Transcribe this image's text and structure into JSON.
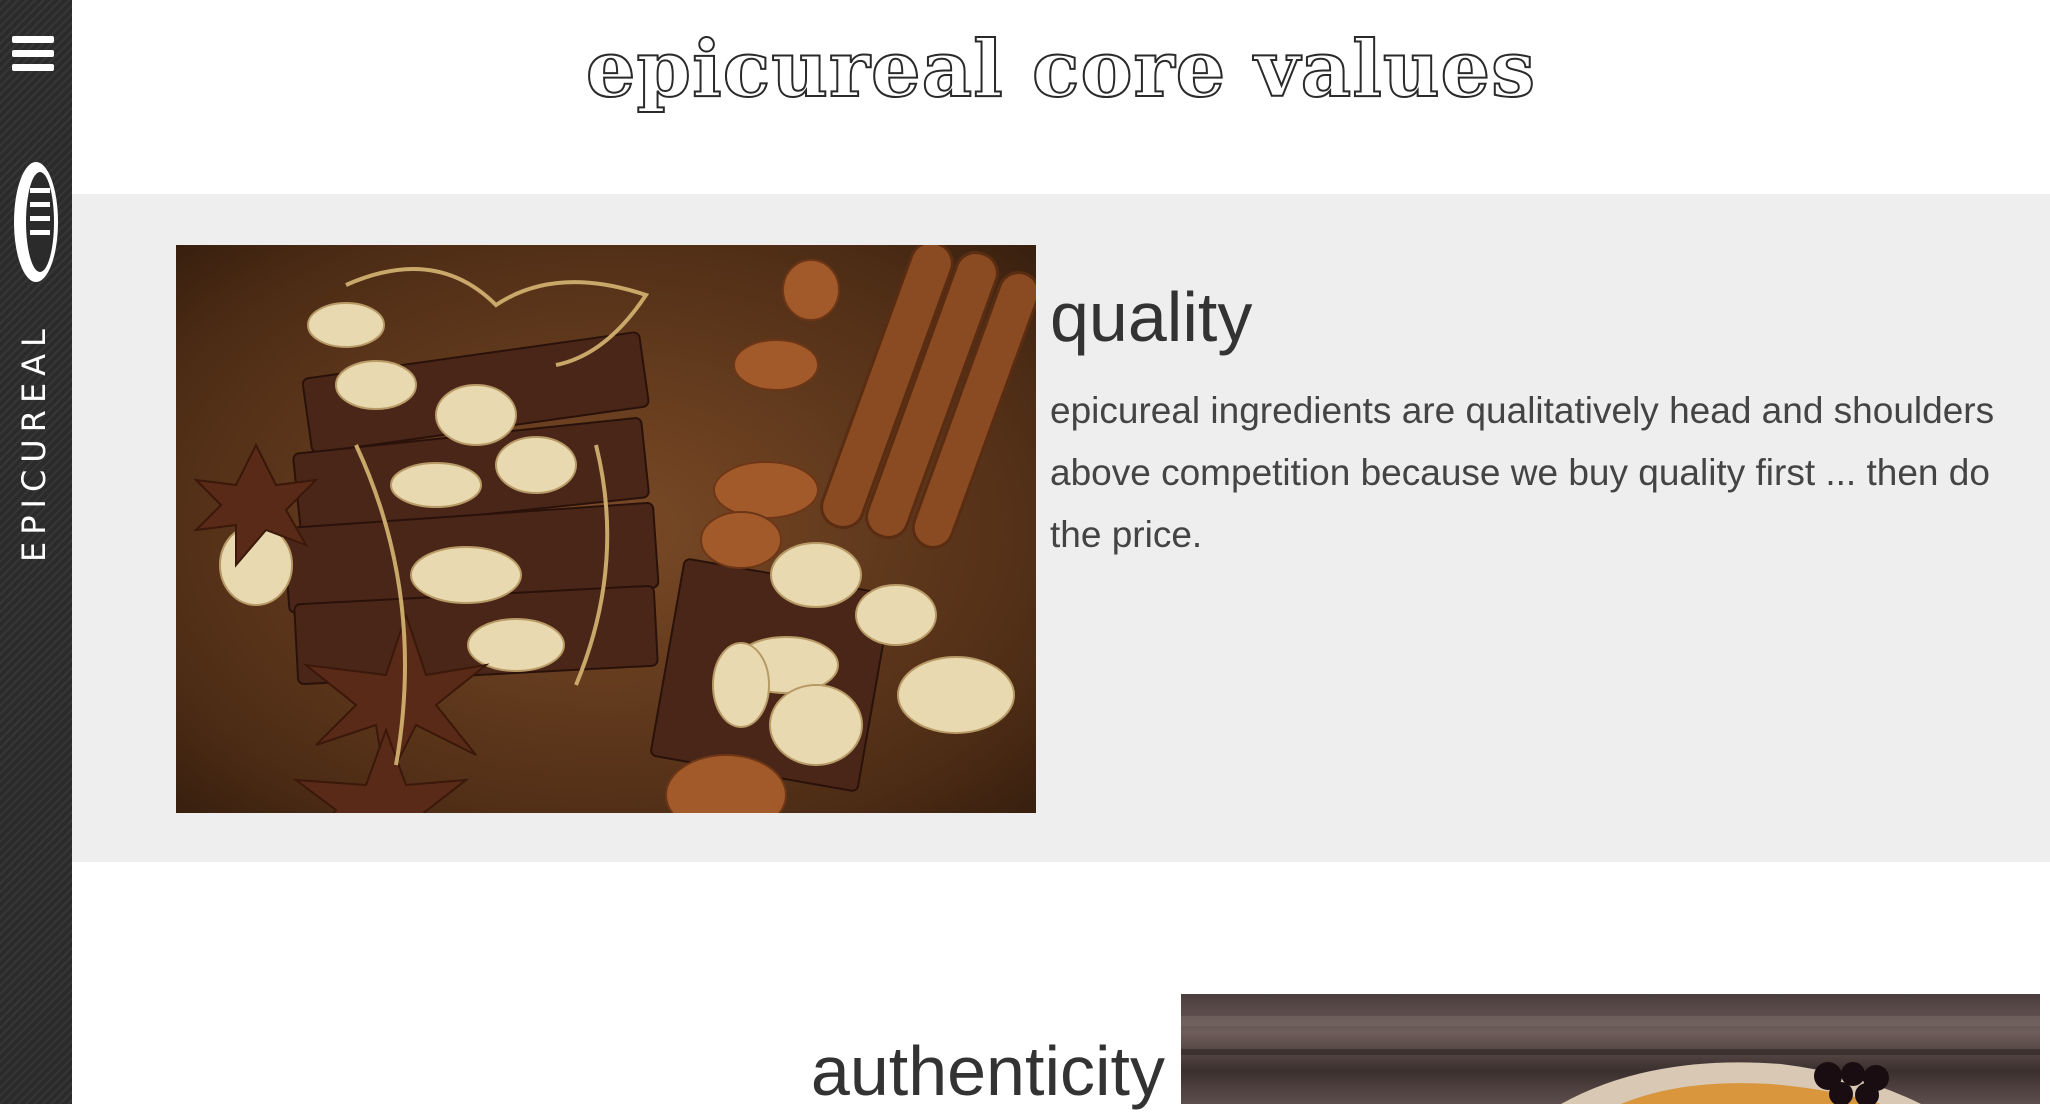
{
  "sidebar": {
    "brand": "EPICUREAL",
    "menu_icon": "hamburger-menu-icon",
    "logo_icon": "fork-icon"
  },
  "page": {
    "title": "epicureal core values"
  },
  "values": [
    {
      "heading": "quality",
      "body": "epicureal ingredients are qualitatively head and shoulders above competition because we buy quality first ... then do the price.",
      "image": "chocolate-almonds-cinnamon-photo"
    },
    {
      "heading": "authenticity",
      "image": "dessert-berries-photo"
    }
  ],
  "colors": {
    "sidebar_bg": "#2b2b2b",
    "band_bg": "#eeeeee",
    "text": "#333333"
  }
}
